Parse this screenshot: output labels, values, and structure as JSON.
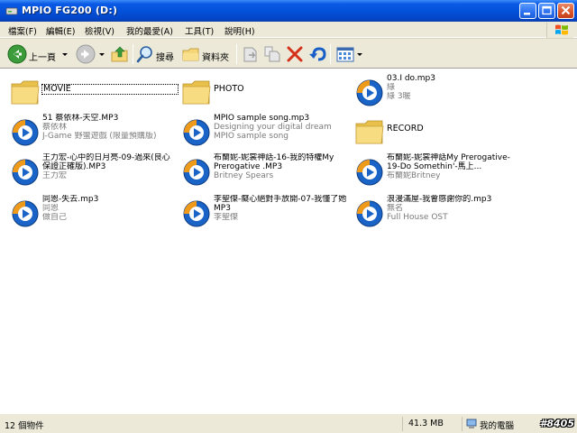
{
  "window": {
    "title": "MPIO FG200 (D:)"
  },
  "menu": {
    "items": [
      "檔案(F)",
      "編輯(E)",
      "檢視(V)",
      "我的最愛(A)",
      "工具(T)",
      "說明(H)"
    ]
  },
  "toolbar": {
    "back_label": "上一頁",
    "search_label": "搜尋",
    "folders_label": "資料夾"
  },
  "files": [
    {
      "name": "MOVIE",
      "type": "folder",
      "selected": true
    },
    {
      "name": "PHOTO",
      "type": "folder"
    },
    {
      "name": "03.I do.mp3",
      "type": "media",
      "line2": "綠",
      "line3": "綠 3暖"
    },
    {
      "name": "51 蔡依林-天空.MP3",
      "type": "media",
      "line2": "蔡依林",
      "line3": "J-Game 野蠻遊戲 (限量預購版)"
    },
    {
      "name": "MPIO sample song.mp3",
      "type": "media",
      "line2": "Designing your digital dream",
      "line3": "MPIO sample song"
    },
    {
      "name": "RECORD",
      "type": "folder"
    },
    {
      "name": "王力宏-心中的日月亮-09-過來(良心保證正確版).MP3",
      "type": "media",
      "line2": "王力宏",
      "line3": ""
    },
    {
      "name": "布蘭妮-妮裳神話-16-我的特權My Prerogative .MP3",
      "type": "media",
      "line2": "Britney Spears",
      "line3": ""
    },
    {
      "name": "布蘭妮-妮裳神話My Prerogative-19-Do Somethin'-馬上...",
      "type": "media",
      "line2": "布蘭妮Britney",
      "line3": ""
    },
    {
      "name": "同恩-失去.mp3",
      "type": "media",
      "line2": "同恩",
      "line3": "做自己"
    },
    {
      "name": "李聖傑-癡心絕對手放開-07-我懂了她 MP3",
      "type": "media",
      "line2": "李聖傑",
      "line3": ""
    },
    {
      "name": "浪漫滿屋-我會感謝你的.mp3",
      "type": "media",
      "line2": "無名",
      "line3": "Full House OST"
    }
  ],
  "status": {
    "count": "12 個物件",
    "size": "41.3 MB",
    "location": "我的電腦"
  },
  "watermark": "#8405",
  "colors": {
    "title_bar": "#0450d8",
    "chrome": "#ece9d8",
    "folder": "#f5d679",
    "media_blue": "#1a64c8",
    "media_orange": "#f09a1a"
  }
}
